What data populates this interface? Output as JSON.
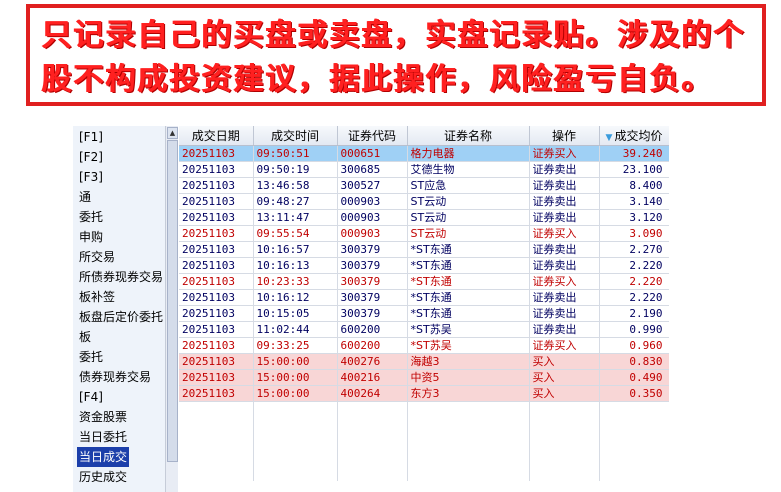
{
  "banner": {
    "line1": "只记录自己的买盘或卖盘，实盘记录贴。涉及的个",
    "line2": "股不构成投资建议，据此操作，风险盈亏自负。"
  },
  "tree": {
    "items": [
      {
        "label": "[F1]"
      },
      {
        "label": "[F2]"
      },
      {
        "label": "[F3]"
      },
      {
        "label": "通"
      },
      {
        "label": "委托"
      },
      {
        "label": "申购"
      },
      {
        "label": "所交易"
      },
      {
        "label": "所债券现券交易"
      },
      {
        "label": "板补签"
      },
      {
        "label": "板盘后定价委托"
      },
      {
        "label": "板"
      },
      {
        "label": "委托"
      },
      {
        "label": "债券现券交易"
      },
      {
        "label": "[F4]"
      },
      {
        "label": "资金股票"
      },
      {
        "label": "当日委托"
      },
      {
        "label": "当日成交"
      },
      {
        "label": "历史成交"
      }
    ],
    "selected_index": 16
  },
  "table": {
    "columns": [
      "成交日期",
      "成交时间",
      "证券代码",
      "证券名称",
      "操作",
      "成交均价"
    ],
    "sort_indicator": "▼",
    "rows": [
      {
        "date": "20251103",
        "time": "09:50:51",
        "code": "000651",
        "name": "格力电器",
        "op": "证券买入",
        "price": "39.240",
        "style": "selected"
      },
      {
        "date": "20251103",
        "time": "09:50:19",
        "code": "300685",
        "name": "艾德生物",
        "op": "证券卖出",
        "price": "23.100",
        "style": "sell"
      },
      {
        "date": "20251103",
        "time": "13:46:58",
        "code": "300527",
        "name": "ST应急",
        "op": "证券卖出",
        "price": "8.400",
        "style": "sell"
      },
      {
        "date": "20251103",
        "time": "09:48:27",
        "code": "000903",
        "name": "ST云动",
        "op": "证券卖出",
        "price": "3.140",
        "style": "sell"
      },
      {
        "date": "20251103",
        "time": "13:11:47",
        "code": "000903",
        "name": "ST云动",
        "op": "证券卖出",
        "price": "3.120",
        "style": "sell"
      },
      {
        "date": "20251103",
        "time": "09:55:54",
        "code": "000903",
        "name": "ST云动",
        "op": "证券买入",
        "price": "3.090",
        "style": "buy"
      },
      {
        "date": "20251103",
        "time": "10:16:57",
        "code": "300379",
        "name": "*ST东通",
        "op": "证券卖出",
        "price": "2.270",
        "style": "sell"
      },
      {
        "date": "20251103",
        "time": "10:16:13",
        "code": "300379",
        "name": "*ST东通",
        "op": "证券卖出",
        "price": "2.220",
        "style": "sell"
      },
      {
        "date": "20251103",
        "time": "10:23:33",
        "code": "300379",
        "name": "*ST东通",
        "op": "证券买入",
        "price": "2.220",
        "style": "buy"
      },
      {
        "date": "20251103",
        "time": "10:16:12",
        "code": "300379",
        "name": "*ST东通",
        "op": "证券卖出",
        "price": "2.220",
        "style": "sell"
      },
      {
        "date": "20251103",
        "time": "10:15:05",
        "code": "300379",
        "name": "*ST东通",
        "op": "证券卖出",
        "price": "2.190",
        "style": "sell"
      },
      {
        "date": "20251103",
        "time": "11:02:44",
        "code": "600200",
        "name": "*ST苏吴",
        "op": "证券卖出",
        "price": "0.990",
        "style": "sell"
      },
      {
        "date": "20251103",
        "time": "09:33:25",
        "code": "600200",
        "name": "*ST苏吴",
        "op": "证券买入",
        "price": "0.960",
        "style": "buy"
      },
      {
        "date": "20251103",
        "time": "15:00:00",
        "code": "400276",
        "name": "海越3",
        "op": "买入",
        "price": "0.830",
        "style": "pink"
      },
      {
        "date": "20251103",
        "time": "15:00:00",
        "code": "400216",
        "name": "中资5",
        "op": "买入",
        "price": "0.490",
        "style": "pink"
      },
      {
        "date": "20251103",
        "time": "15:00:00",
        "code": "400264",
        "name": "东方3",
        "op": "买入",
        "price": "0.350",
        "style": "pink"
      }
    ]
  },
  "colors": {
    "banner_text": "#ff2020",
    "banner_border": "#e02020",
    "buy_text": "#c00000",
    "sell_text": "#000060",
    "selected_row": "#9fd0f5",
    "pink_row": "#f8d6d6",
    "tree_selected": "#1c3faa"
  }
}
